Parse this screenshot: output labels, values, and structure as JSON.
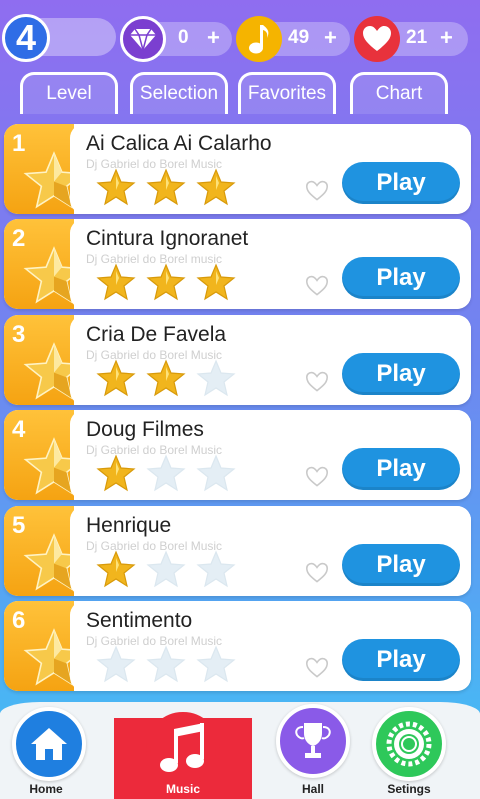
{
  "header": {
    "level": "4",
    "gems": {
      "count": "0",
      "plus": "+",
      "icon": "diamond-icon",
      "color": "#7b3fd0"
    },
    "notes": {
      "count": "49",
      "plus": "+",
      "icon": "music-note-icon",
      "color": "#f5b400"
    },
    "lives": {
      "count": "21",
      "plus": "+",
      "icon": "heart-icon",
      "color": "#e8323c"
    }
  },
  "tabs": [
    {
      "label": "Level"
    },
    {
      "label": "Selection"
    },
    {
      "label": "Favorites"
    },
    {
      "label": "Chart"
    }
  ],
  "songs": [
    {
      "number": "1",
      "title": "Ai Calica Ai Calarho",
      "artist": "Dj Gabriel do Borel Music",
      "stars": 3,
      "play_label": "Play"
    },
    {
      "number": "2",
      "title": "Cintura Ignoranet",
      "artist": "Dj Gabriel do Borel music",
      "stars": 3,
      "play_label": "Play"
    },
    {
      "number": "3",
      "title": "Cria De Favela",
      "artist": "Dj Gabriel do Borel Music",
      "stars": 2,
      "play_label": "Play"
    },
    {
      "number": "4",
      "title": "Doug Filmes",
      "artist": "Dj Gabriel do Borel Music",
      "stars": 1,
      "play_label": "Play"
    },
    {
      "number": "5",
      "title": "Henrique",
      "artist": "Dj Gabriel do Borel Music",
      "stars": 1,
      "play_label": "Play"
    },
    {
      "number": "6",
      "title": "Sentimento",
      "artist": "Dj Gabriel do Borel Music",
      "stars": 0,
      "play_label": "Play"
    }
  ],
  "nav": {
    "home": {
      "label": "Home",
      "icon": "home-icon",
      "color": "#1f7fe0"
    },
    "music": {
      "label": "Music",
      "icon": "music-note-icon",
      "color": "#ec2a3b"
    },
    "hall": {
      "label": "Hall",
      "icon": "trophy-icon",
      "color": "#8a5ae8"
    },
    "settings": {
      "label": "Setings",
      "icon": "gear-icon",
      "color": "#2ec85a"
    }
  },
  "colors": {
    "play_button": "#1f93e0",
    "card_accent": "#f5a312",
    "star_gold": "#f1b51d",
    "star_empty": "#e4eef5"
  }
}
